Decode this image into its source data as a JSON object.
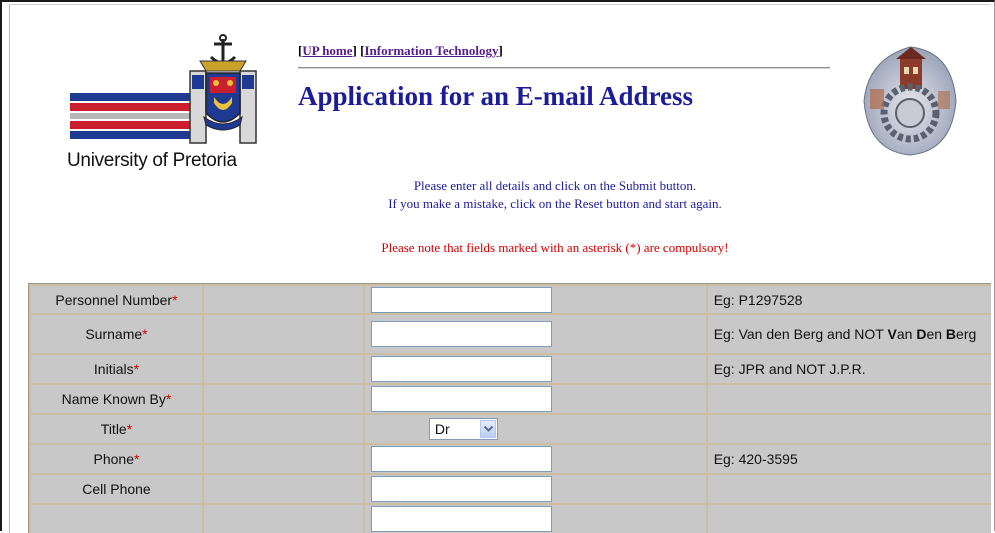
{
  "header": {
    "links": [
      {
        "text": "UP home"
      },
      {
        "text": "Information Technology"
      }
    ],
    "title": "Application for an E-mail Address"
  },
  "logo": {
    "caption": "University of Pretoria",
    "icon": "university-crest-logo",
    "emblem_icon": "campus-building-emblem"
  },
  "instructions": {
    "line1": "Please enter all details and click on the Submit button.",
    "line2": "If you make a mistake, click on the Reset button and start again.",
    "note": "Please note that fields marked with an asterisk (*) are compulsory!"
  },
  "colors": {
    "title": "#1c1c9a",
    "required": "#cc0000",
    "link": "#551a8b",
    "table_bg": "#c8c8c8"
  },
  "form": {
    "required_mark": "*",
    "fields": [
      {
        "label": "Personnel Number",
        "required": true,
        "type": "text",
        "value": "",
        "example": "Eg: P1297528"
      },
      {
        "label": "Surname",
        "required": true,
        "type": "text",
        "value": "",
        "example_parts": [
          "Eg: Van den Berg and NOT ",
          "V",
          "an ",
          "D",
          "en",
          "B",
          "erg"
        ]
      },
      {
        "label": "Initials",
        "required": true,
        "type": "text",
        "value": "",
        "example": "Eg: JPR and NOT J.P.R."
      },
      {
        "label": "Name Known By",
        "required": true,
        "type": "text",
        "value": "",
        "example": ""
      },
      {
        "label": "Title",
        "required": true,
        "type": "select",
        "value": "Dr",
        "example": ""
      },
      {
        "label": "Phone",
        "required": true,
        "type": "text",
        "value": "",
        "example": "Eg: 420-3595"
      },
      {
        "label": "Cell Phone",
        "required": false,
        "type": "text",
        "value": "",
        "example": ""
      }
    ]
  }
}
